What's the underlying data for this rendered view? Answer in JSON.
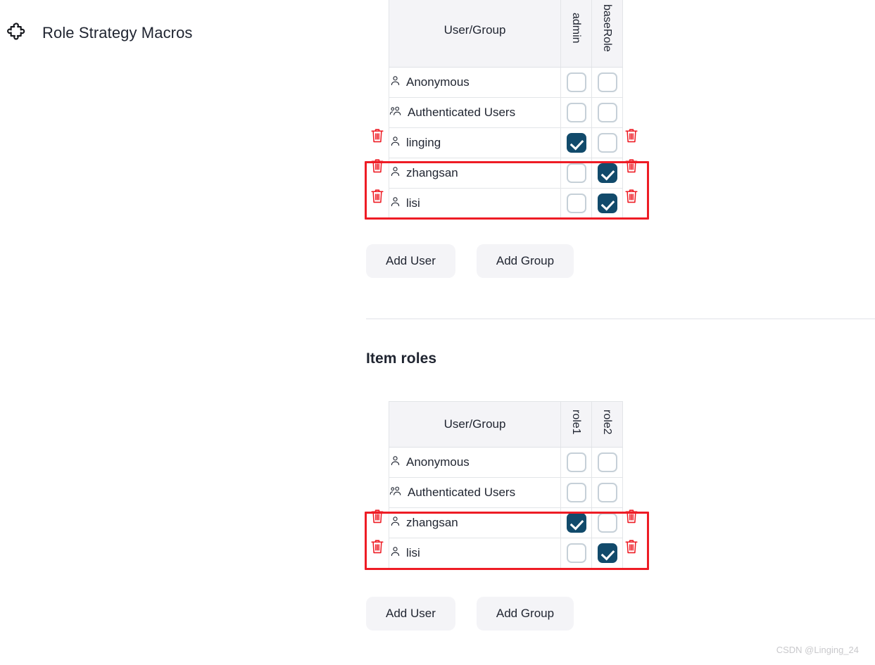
{
  "plugin": {
    "icon": "puzzle-piece-icon",
    "title": "Role Strategy Macros"
  },
  "colors": {
    "checkbox_checked": "#114A6B",
    "checkbox_border": "#c6d0d8",
    "annotation_red": "#ee1c25",
    "trash_red": "#ee1c25",
    "header_bg": "#f4f4f7",
    "button_bg": "#f4f4f7",
    "divider": "#eeeff3",
    "text": "#1f2430"
  },
  "sections": [
    {
      "id": "global-roles",
      "heading": "",
      "table": {
        "columns": [
          {
            "key": "usergroup",
            "label": "User/Group",
            "orientation": "horizontal"
          },
          {
            "key": "admin",
            "label": "admin",
            "orientation": "vertical"
          },
          {
            "key": "baseRole",
            "label": "baseRole",
            "orientation": "vertical"
          }
        ],
        "rows": [
          {
            "name": "Anonymous",
            "icon": "person-icon",
            "checks": [
              false,
              false
            ],
            "deletable": false,
            "highlighted": false
          },
          {
            "name": "Authenticated Users",
            "icon": "group-icon",
            "checks": [
              false,
              false
            ],
            "deletable": false,
            "highlighted": false
          },
          {
            "name": "linging",
            "icon": "person-icon",
            "checks": [
              true,
              false
            ],
            "deletable": true,
            "highlighted": false
          },
          {
            "name": "zhangsan",
            "icon": "person-icon",
            "checks": [
              false,
              true
            ],
            "deletable": true,
            "highlighted": true
          },
          {
            "name": "lisi",
            "icon": "person-icon",
            "checks": [
              false,
              true
            ],
            "deletable": true,
            "highlighted": true
          }
        ]
      },
      "buttons": [
        {
          "id": "add-user",
          "label": "Add User"
        },
        {
          "id": "add-group",
          "label": "Add Group"
        }
      ]
    },
    {
      "id": "item-roles",
      "heading": "Item roles",
      "table": {
        "columns": [
          {
            "key": "usergroup",
            "label": "User/Group",
            "orientation": "horizontal"
          },
          {
            "key": "role1",
            "label": "role1",
            "orientation": "vertical"
          },
          {
            "key": "role2",
            "label": "role2",
            "orientation": "vertical"
          }
        ],
        "rows": [
          {
            "name": "Anonymous",
            "icon": "person-icon",
            "checks": [
              false,
              false
            ],
            "deletable": false,
            "highlighted": false
          },
          {
            "name": "Authenticated Users",
            "icon": "group-icon",
            "checks": [
              false,
              false
            ],
            "deletable": false,
            "highlighted": false
          },
          {
            "name": "zhangsan",
            "icon": "person-icon",
            "checks": [
              true,
              false
            ],
            "deletable": true,
            "highlighted": true
          },
          {
            "name": "lisi",
            "icon": "person-icon",
            "checks": [
              false,
              true
            ],
            "deletable": true,
            "highlighted": true
          }
        ]
      },
      "buttons": [
        {
          "id": "add-user",
          "label": "Add User"
        },
        {
          "id": "add-group",
          "label": "Add Group"
        }
      ]
    }
  ],
  "watermark": "CSDN @Linging_24"
}
